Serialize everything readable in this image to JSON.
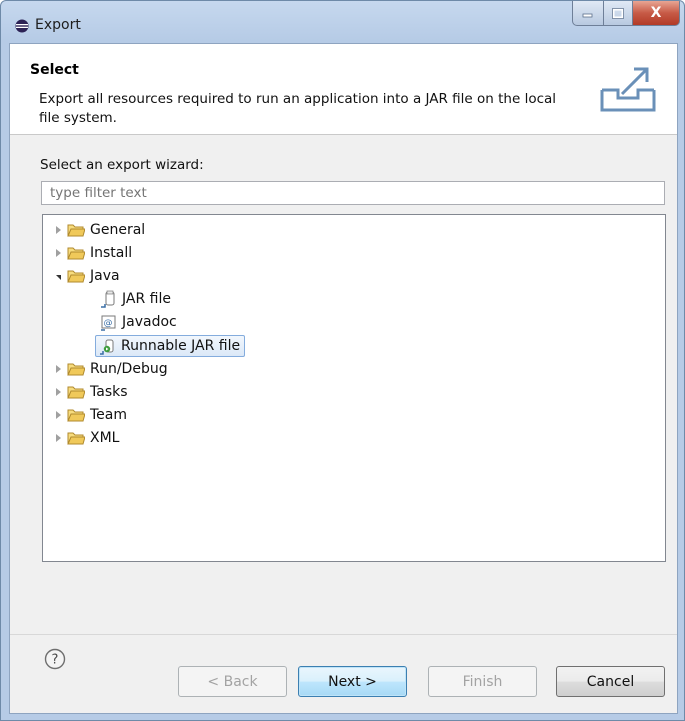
{
  "window": {
    "title": "Export",
    "minimize_label": "–",
    "maximize_label": "□",
    "close_label": "X"
  },
  "header": {
    "title": "Select",
    "description": "Export all resources required to run an application into a JAR file on the local file system.",
    "icon": "export-icon"
  },
  "wizard": {
    "label": "Select an export wizard:",
    "filter_placeholder": "type filter text",
    "filter_value": ""
  },
  "tree": {
    "items": [
      {
        "label": "General",
        "type": "folder",
        "expanded": false
      },
      {
        "label": "Install",
        "type": "folder",
        "expanded": false
      },
      {
        "label": "Java",
        "type": "folder",
        "expanded": true
      },
      {
        "label": "JAR file",
        "type": "jar",
        "icon": "jar-file-icon"
      },
      {
        "label": "Javadoc",
        "type": "javadoc",
        "icon": "javadoc-icon"
      },
      {
        "label": "Runnable JAR file",
        "type": "runnable-jar",
        "icon": "runnable-jar-icon",
        "selected": true
      },
      {
        "label": "Run/Debug",
        "type": "folder",
        "expanded": false
      },
      {
        "label": "Tasks",
        "type": "folder",
        "expanded": false
      },
      {
        "label": "Team",
        "type": "folder",
        "expanded": false
      },
      {
        "label": "XML",
        "type": "folder",
        "expanded": false
      }
    ]
  },
  "buttons": {
    "back": "< Back",
    "next": "Next >",
    "finish": "Finish",
    "cancel": "Cancel"
  },
  "colors": {
    "selection_border": "#84acdd",
    "folder": "#e9c25b",
    "default_button": "#3c7fb1"
  }
}
